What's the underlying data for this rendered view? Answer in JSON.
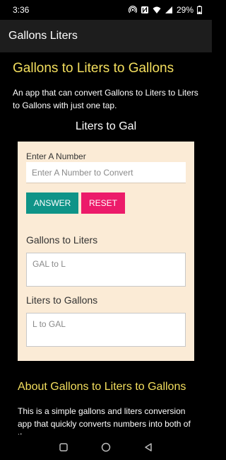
{
  "status_bar": {
    "time": "3:36",
    "battery": "29%"
  },
  "app_bar": {
    "title": "Gallons Liters"
  },
  "main": {
    "title": "Gallons to Liters to Gallons",
    "intro": "An app that can convert Gallons to Liters to Liters to Gallons with just one tap.",
    "section_title": "Liters to Gal",
    "converter": {
      "input_label": "Enter A Number",
      "input_placeholder": "Enter A Number to Convert",
      "answer_label": "ANSWER",
      "reset_label": "RESET",
      "gallons_to_liters_label": "Gallons to Liters",
      "gallons_to_liters_placeholder": "GAL to L",
      "liters_to_gallons_label": "Liters to Gallons",
      "liters_to_gallons_placeholder": "L to GAL"
    },
    "about_title": "About Gallons to Liters to Gallons",
    "about_text": "This is a simple gallons and liters conversion app that quickly converts numbers into both of these"
  },
  "colors": {
    "accent_yellow": "#f4df5e",
    "answer_button": "#0f9488",
    "reset_button": "#ec1b6a",
    "card_background": "#fbebd6"
  },
  "icons": {
    "status": [
      "hotspot-icon",
      "nfc-icon",
      "wifi-icon",
      "signal-icon",
      "battery-icon"
    ],
    "nav": [
      "recents-icon",
      "home-icon",
      "back-icon"
    ]
  }
}
